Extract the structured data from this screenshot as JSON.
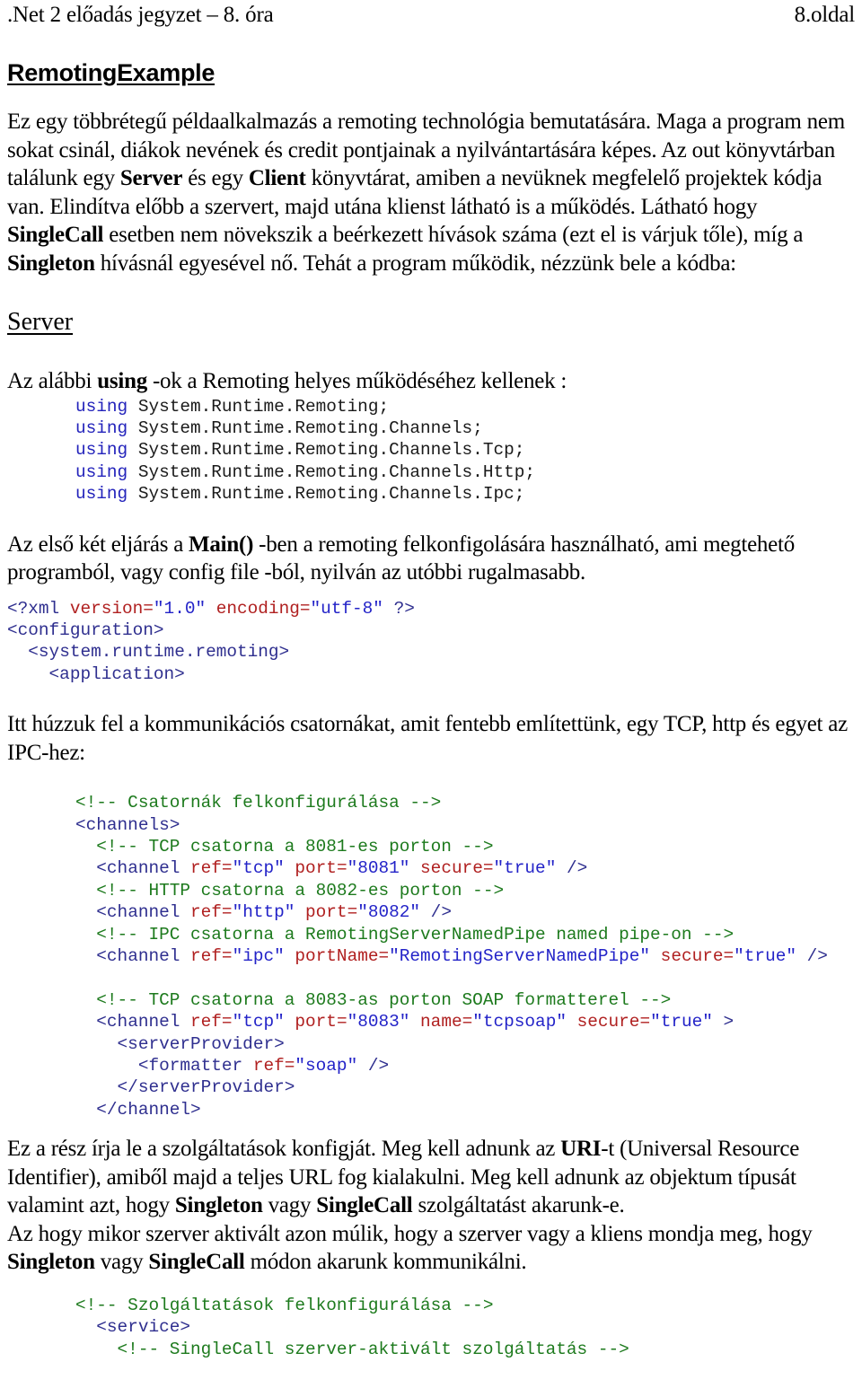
{
  "header": {
    "left": ".Net 2 előadás jegyzet – 8. óra",
    "right": "8.oldal"
  },
  "title": "RemotingExample",
  "intro_paragraph": {
    "part1": "Ez egy többrétegű példaalkalmazás a remoting technológia bemutatására. Maga a program nem sokat csinál, diákok nevének és credit pontjainak a nyilvántartására képes. Az out könyvtárban találunk egy ",
    "bold1": "Server",
    "part2": " és egy ",
    "bold2": "Client",
    "part3": " könyvtárat, amiben a nevüknek megfelelő projektek kódja van. Elindítva előbb a szervert, majd utána klienst látható is a működés. Látható hogy ",
    "bold3": "SingleCall",
    "part4": " esetben nem növekszik a beérkezett hívások száma (ezt el is várjuk tőle), míg a ",
    "bold4": "Singleton",
    "part5": " hívásnál egyesével nő. Tehát a program működik, nézzünk bele a kódba:"
  },
  "server_heading": "Server",
  "using_intro": {
    "part1": "Az alábbi ",
    "bold1": "using",
    "part2": " -ok a Remoting helyes működéséhez kellenek :"
  },
  "using_lines": [
    {
      "kw": "using",
      "ns": " System.Runtime.Remoting;"
    },
    {
      "kw": "using",
      "ns": " System.Runtime.Remoting.Channels;"
    },
    {
      "kw": "using",
      "ns": " System.Runtime.Remoting.Channels.Tcp;"
    },
    {
      "kw": "using",
      "ns": " System.Runtime.Remoting.Channels.Http;"
    },
    {
      "kw": "using",
      "ns": " System.Runtime.Remoting.Channels.Ipc;"
    }
  ],
  "main_paragraph": {
    "part1": "Az első két eljárás a ",
    "bold1": "Main()",
    "part2": " -ben a remoting felkonfigolására használható, ami megtehető programból, vagy config file -ból, nyilván az utóbbi rugalmasabb."
  },
  "xml_decl": {
    "open": "<?xml",
    "attr1": " version",
    "eq1": "=",
    "val1": "\"1.0\"",
    "attr2": " encoding",
    "eq2": "=",
    "val2": "\"utf-8\"",
    "close": " ?>"
  },
  "xml_open_tags": {
    "configuration": "<configuration>",
    "system_runtime_remoting": "  <system.runtime.remoting>",
    "application": "    <application>"
  },
  "channels_paragraph": "Itt húzzuk fel a kommunikációs csatornákat, amit fentebb említettünk, egy TCP, http és egyet az IPC-hez:",
  "channels_code": {
    "comment_channels": "<!-- Csatornák felkonfigurálása -->",
    "tag_channels_open": "<channels>",
    "comment_tcp": "  <!-- TCP csatorna a 8081-es porton -->",
    "tcp_channel": {
      "tag_open": "  <channel",
      "attr_ref": " ref",
      "val_ref": "\"tcp\"",
      "attr_port": " port",
      "val_port": "\"8081\"",
      "attr_secure": " secure",
      "val_secure": "\"true\"",
      "tag_close": " />"
    },
    "comment_http": "  <!-- HTTP csatorna a 8082-es porton -->",
    "http_channel": {
      "tag_open": "  <channel",
      "attr_ref": " ref",
      "val_ref": "\"http\"",
      "attr_port": " port",
      "val_port": "\"8082\"",
      "tag_close": " />"
    },
    "comment_ipc": "  <!-- IPC csatorna a RemotingServerNamedPipe named pipe-on -->",
    "ipc_channel": {
      "tag_open": "  <channel",
      "attr_ref": " ref",
      "val_ref": "\"ipc\"",
      "attr_portname": " portName",
      "val_portname": "\"RemotingServerNamedPipe\"",
      "attr_secure": " secure",
      "val_secure": "\"true\"",
      "tag_close": " />"
    },
    "comment_soap": "  <!-- TCP csatorna a 8083-as porton SOAP formatterel -->",
    "soap_channel": {
      "tag_open": "  <channel",
      "attr_ref": " ref",
      "val_ref": "\"tcp\"",
      "attr_port": " port",
      "val_port": "\"8083\"",
      "attr_name": " name",
      "val_name": "\"tcpsoap\"",
      "attr_secure": " secure",
      "val_secure": "\"true\"",
      "tag_close": " >"
    },
    "tag_serverprovider_open": "    <serverProvider>",
    "formatter": {
      "tag_open": "      <formatter",
      "attr_ref": " ref",
      "val_ref": "\"soap\"",
      "tag_close": " />"
    },
    "tag_serverprovider_close": "    </serverProvider>",
    "tag_channel_close": "  </channel>"
  },
  "services_paragraph": {
    "part1": "Ez a rész írja le a szolgáltatások konfigját. Meg kell adnunk az ",
    "bold1": "URI",
    "part2": "-t (Universal Resource Identifier), amiből majd a teljes URL fog kialakulni. Meg kell adnunk az objektum típusát valamint azt, hogy ",
    "bold2": "Singleton",
    "part3": " vagy ",
    "bold3": "SingleCall",
    "part4": " szolgáltatást akarunk-e."
  },
  "activation_paragraph": {
    "part1": "Az hogy mikor szerver aktivált azon múlik, hogy a szerver vagy a kliens mondja meg, hogy ",
    "bold1": "Singleton",
    "part2": " vagy ",
    "bold2": "SingleCall",
    "part3": " módon akarunk kommunikálni."
  },
  "services_code": {
    "comment_services": "<!-- Szolgáltatások felkonfigurálása -->",
    "tag_service_open": "  <service>",
    "comment_singlecall": "    <!-- SingleCall szerver-aktivált szolgáltatás -->"
  },
  "colors": {
    "keyword": "#2323bb",
    "tag": "#2f2f8f",
    "attribute": "#b02020",
    "value": "#2323c8",
    "comment": "#1d7a1d",
    "text": "#000000",
    "background": "#ffffff"
  }
}
